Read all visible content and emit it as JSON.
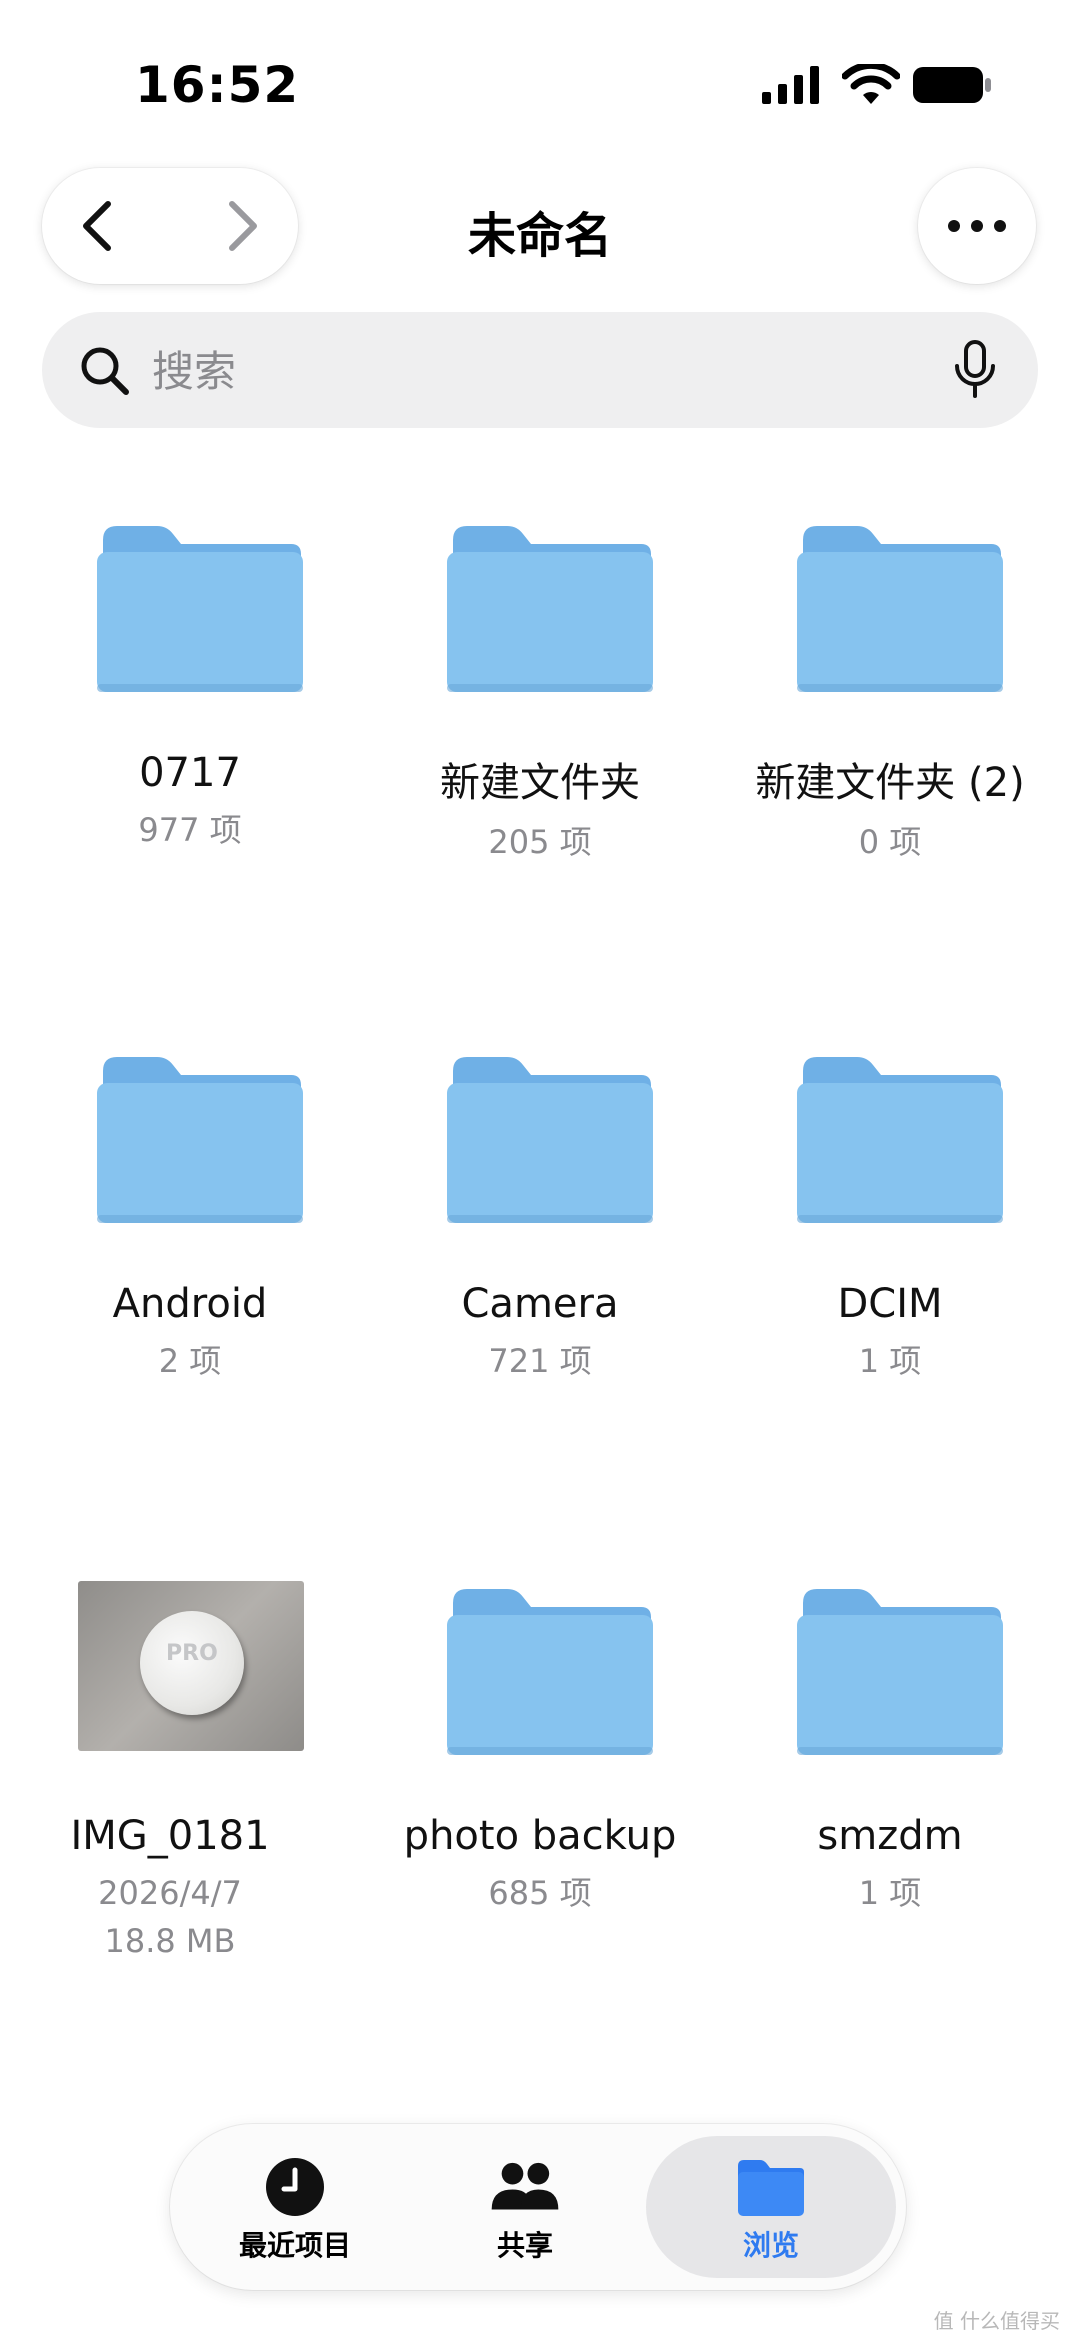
{
  "status_bar": {
    "time": "16:52"
  },
  "header": {
    "title": "未命名"
  },
  "search": {
    "placeholder": "搜索"
  },
  "items": [
    {
      "type": "folder",
      "name": "0717",
      "meta": "977 项"
    },
    {
      "type": "folder",
      "name": "新建文件夹",
      "meta": "205 项"
    },
    {
      "type": "folder",
      "name": "新建文件夹 (2)",
      "meta": "0 项"
    },
    {
      "type": "folder",
      "name": "Android",
      "meta": "2 项"
    },
    {
      "type": "folder",
      "name": "Camera",
      "meta": "721 项"
    },
    {
      "type": "folder",
      "name": "DCIM",
      "meta": "1 项"
    },
    {
      "type": "image",
      "name": "IMG_0181",
      "meta": "2026/4/7",
      "meta2": "18.8 MB",
      "thumb_text": "PRO"
    },
    {
      "type": "folder",
      "name": "photo backup",
      "meta": "685 项"
    },
    {
      "type": "folder",
      "name": "smzdm",
      "meta": "1 项"
    }
  ],
  "tabs": [
    {
      "label": "最近项目",
      "icon": "clock-icon"
    },
    {
      "label": "共享",
      "icon": "people-icon"
    },
    {
      "label": "浏览",
      "icon": "folder-icon",
      "selected": true
    }
  ],
  "colors": {
    "accent": "#2f7bf0",
    "folder": "#7fbbea"
  },
  "watermark": "值 什么值得买"
}
